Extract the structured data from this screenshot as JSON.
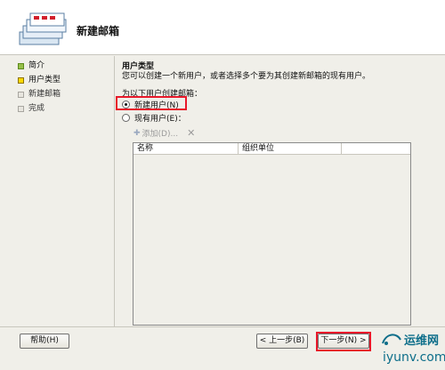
{
  "header": {
    "title": "新建邮箱",
    "icon": "mailbox-stack-icon"
  },
  "nav": {
    "items": [
      {
        "label": "简介",
        "state": "done"
      },
      {
        "label": "用户类型",
        "state": "current"
      },
      {
        "label": "新建邮箱",
        "state": "pending"
      },
      {
        "label": "完成",
        "state": "pending"
      }
    ]
  },
  "main": {
    "section_title": "用户类型",
    "section_desc": "您可以创建一个新用户，或者选择多个要为其创建新邮箱的现有用户。",
    "prompt": "为以下用户创建邮箱：",
    "options": [
      {
        "label": "新建用户(N)",
        "checked": true
      },
      {
        "label": "现有用户(E)：",
        "checked": false
      }
    ],
    "toolbar": {
      "add_label": "添加(D)...",
      "delete_icon": "delete-x-icon"
    },
    "table": {
      "columns": [
        "名称",
        "组织单位"
      ]
    }
  },
  "footer": {
    "help_label": "帮助(H)",
    "back_label": "< 上一步(B)",
    "next_label": "下一步(N) >"
  },
  "watermark": {
    "top": "运维网",
    "bottom": "iyunv.com"
  },
  "colors": {
    "highlight": "#e8182a",
    "done": "#97c04a",
    "current": "#ffd800",
    "watermark": "#0d6e8a"
  }
}
